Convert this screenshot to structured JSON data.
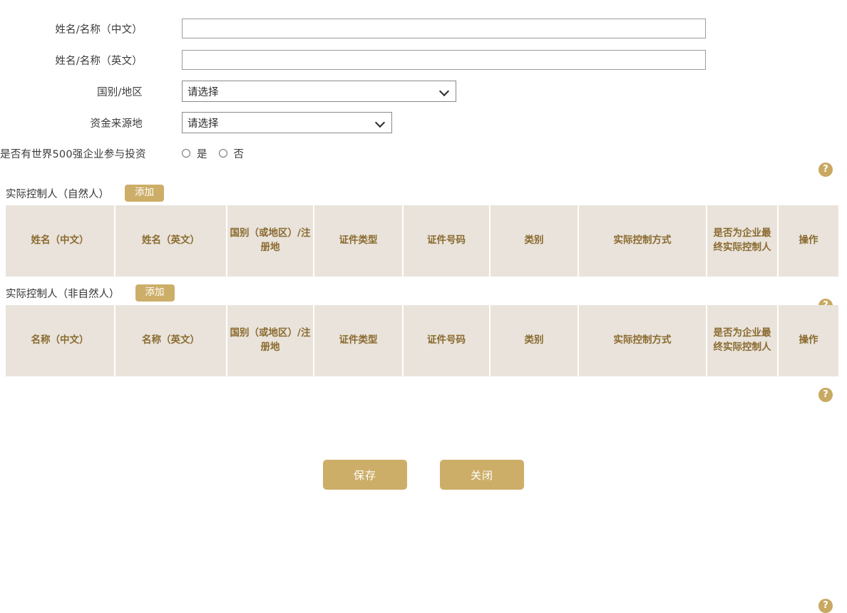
{
  "colors": {
    "accent_gold": "#cdae68",
    "help_badge": "#c9a961",
    "table_header_bg": "#e9e3db",
    "table_header_text": "#8a6a2f"
  },
  "form": {
    "rows": [
      {
        "label": "姓名/名称（中文）",
        "type": "text",
        "value": "",
        "placeholder": ""
      },
      {
        "label": "姓名/名称（英文）",
        "type": "text",
        "value": "",
        "placeholder": ""
      },
      {
        "label": "国别/地区",
        "type": "select",
        "value": "请选择"
      },
      {
        "label": "资金来源地",
        "type": "select",
        "value": "请选择"
      },
      {
        "label": "是否有世界500强企业参与投资",
        "type": "radio"
      }
    ],
    "radio_options": [
      {
        "label": "是",
        "checked": false
      },
      {
        "label": "否",
        "checked": false
      }
    ],
    "help_icon_label": "?"
  },
  "sections": [
    {
      "title": "实际控制人（自然人）",
      "add_label": "添加",
      "columns": [
        "姓名（中文）",
        "姓名（英文）",
        "国别（或地区）/注册地",
        "证件类型",
        "证件号码",
        "类别",
        "实际控制方式",
        "是否为企业最终实际控制人",
        "操作"
      ],
      "rows": []
    },
    {
      "title": "实际控制人（非自然人）",
      "add_label": "添加",
      "columns": [
        "名称（中文）",
        "名称（英文）",
        "国别（或地区）/注册地",
        "证件类型",
        "证件号码",
        "类别",
        "实际控制方式",
        "是否为企业最终实际控制人",
        "操作"
      ],
      "rows": []
    }
  ],
  "footer": {
    "save_label": "保存",
    "close_label": "关闭"
  }
}
